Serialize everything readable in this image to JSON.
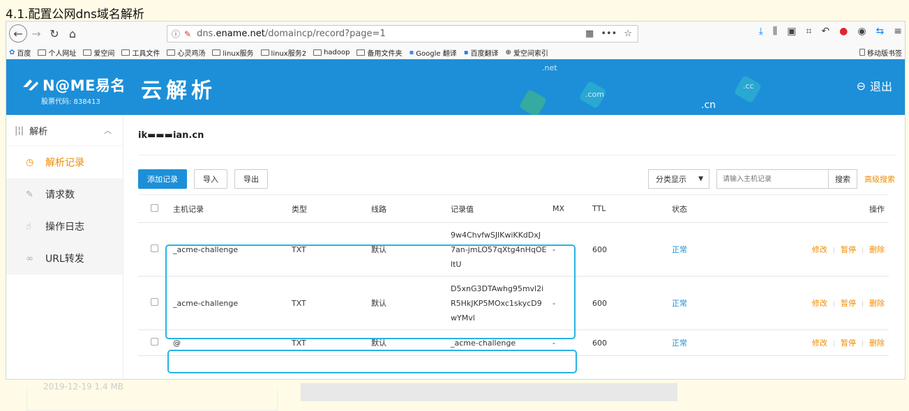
{
  "heading": "4.1.配置公网dns域名解析",
  "browser": {
    "url_prefix": "dns.",
    "url_domain": "ename.net",
    "url_path": "/domaincp/record?page=1",
    "bookmarks": [
      "百度",
      "个人网址",
      "爱空间",
      "工具文件",
      "心灵鸡汤",
      "linux服务",
      "linux服务2",
      "hadoop",
      "备用文件夹",
      "Google 翻译",
      "百度翻译",
      "爱空间索引"
    ],
    "mobile_bookmarks": "移动版书签"
  },
  "site": {
    "logo_name": "N@ME易名",
    "stock_code": "股票代码: 838413",
    "title": "云解析",
    "logout": "退出",
    "tlds": [
      ".net",
      ".com",
      ".cc",
      ".cn"
    ]
  },
  "sidebar": {
    "group": "解析",
    "items": [
      {
        "label": "解析记录",
        "icon": "clock-icon"
      },
      {
        "label": "请求数",
        "icon": "edit-icon"
      },
      {
        "label": "操作日志",
        "icon": "hand-icon"
      },
      {
        "label": "URL转发",
        "icon": "link-icon"
      }
    ]
  },
  "main": {
    "domain": "ik▬▬▬ⅰan.cn",
    "buttons": {
      "add": "添加记录",
      "import": "导入",
      "export": "导出"
    },
    "category": "分类显示",
    "search_placeholder": "请输入主机记录",
    "search_btn": "搜索",
    "advanced": "高级搜索",
    "columns": [
      "主机记录",
      "类型",
      "线路",
      "记录值",
      "MX",
      "TTL",
      "状态",
      "操作"
    ],
    "rows": [
      {
        "host": "_acme-challenge",
        "type": "TXT",
        "line": "默认",
        "value": [
          "9w4ChvfwSJlKwiKKdDxJ",
          "7an-jmLO57qXtg4nHqOE",
          "ltU"
        ],
        "mx": "-",
        "ttl": "600",
        "status": "正常"
      },
      {
        "host": "_acme-challenge",
        "type": "TXT",
        "line": "默认",
        "value": [
          "D5xnG3DTAwhg95mvl2i",
          "R5HkJKP5MOxc1skycD9",
          "wYMvl"
        ],
        "mx": "-",
        "ttl": "600",
        "status": "正常"
      },
      {
        "host": "@",
        "type": "TXT",
        "line": "默认",
        "value": [
          "_acme-challenge"
        ],
        "mx": "-",
        "ttl": "600",
        "status": "正常"
      }
    ],
    "ops": {
      "edit": "修改",
      "pause": "暂停",
      "delete": "删除"
    }
  },
  "bottom": {
    "ghost_text": "2019-12-19   1.4 MB"
  }
}
